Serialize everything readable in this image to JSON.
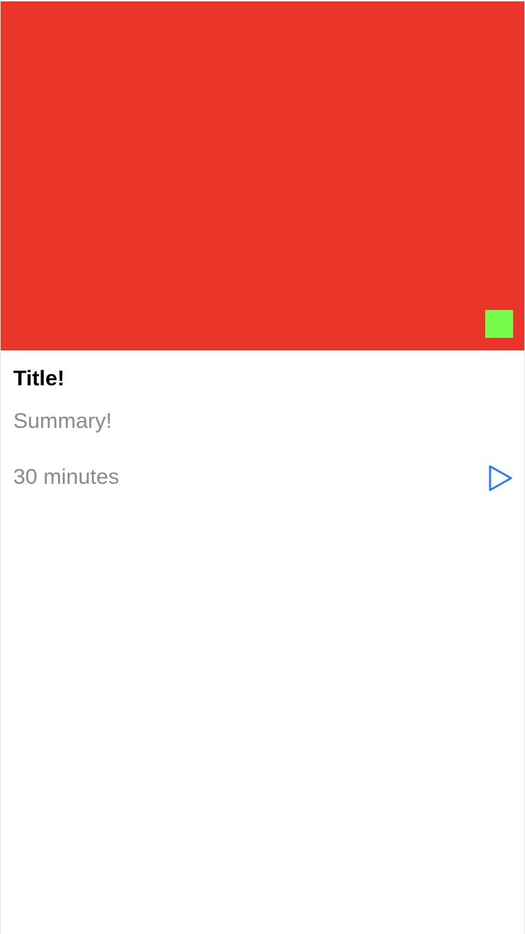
{
  "card": {
    "title": "Title!",
    "summary": "Summary!",
    "duration": "30 minutes",
    "play_icon": "play-icon"
  },
  "colors": {
    "hero": "#E9352A",
    "badge": "#76FA4B",
    "accent": "#2F7CF6",
    "secondary_text": "#8A8A8E",
    "primary_text": "#000000"
  }
}
